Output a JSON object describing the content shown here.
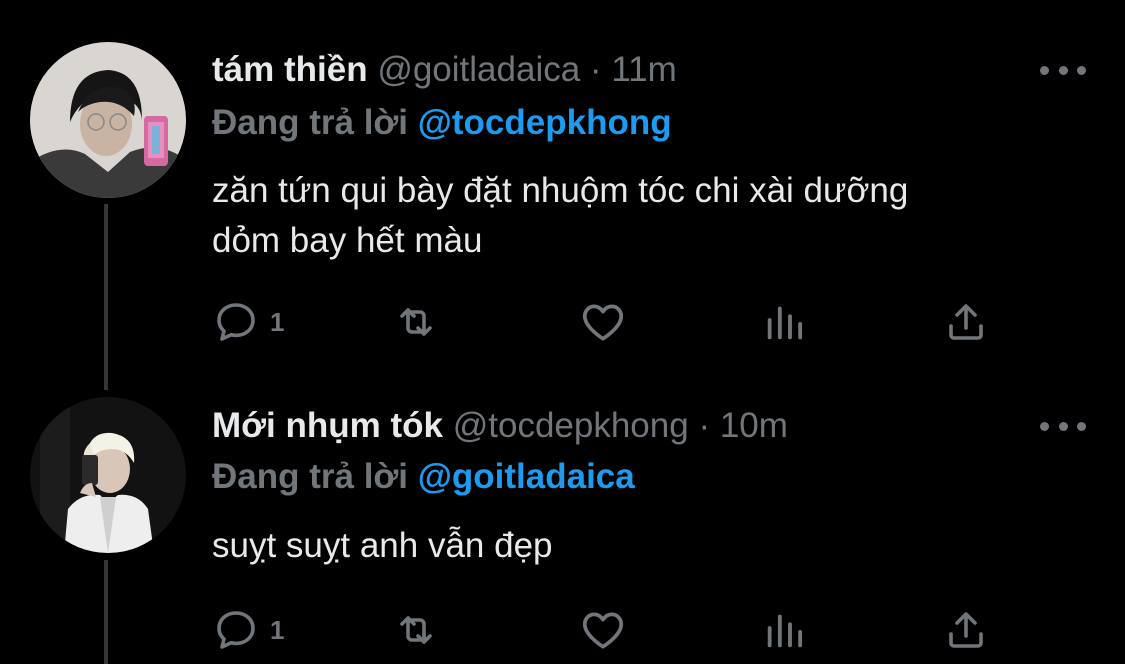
{
  "tweets": [
    {
      "name": "tám thiền",
      "handle": "@goitladaica",
      "separator": "·",
      "time": "11m",
      "replying_prefix": "Đang trả lời",
      "replying_to": "@tocdepkhong",
      "text_lines": [
        "zăn tứn qui bày đặt nhuộm tóc chi xài dưỡng",
        "dỏm bay hết màu"
      ],
      "reply_count": "1",
      "icons": {
        "reply": "comment-icon",
        "retweet": "retweet-icon",
        "like": "heart-icon",
        "views": "analytics-icon",
        "share": "share-icon",
        "more": "more-icon"
      }
    },
    {
      "name": "Mới nhụm tók",
      "handle": "@tocdepkhong",
      "separator": "·",
      "time": "10m",
      "replying_prefix": "Đang trả lời",
      "replying_to": "@goitladaica",
      "text_lines": [
        "suỵt suỵt anh vẫn đẹp"
      ],
      "reply_count": "1",
      "icons": {
        "reply": "comment-icon",
        "retweet": "retweet-icon",
        "like": "heart-icon",
        "views": "analytics-icon",
        "share": "share-icon",
        "more": "more-icon"
      }
    }
  ],
  "colors": {
    "background": "#000000",
    "text": "#e7e9ea",
    "muted": "#71767b",
    "accent": "#1d9bf0",
    "thread_line": "#333639"
  }
}
